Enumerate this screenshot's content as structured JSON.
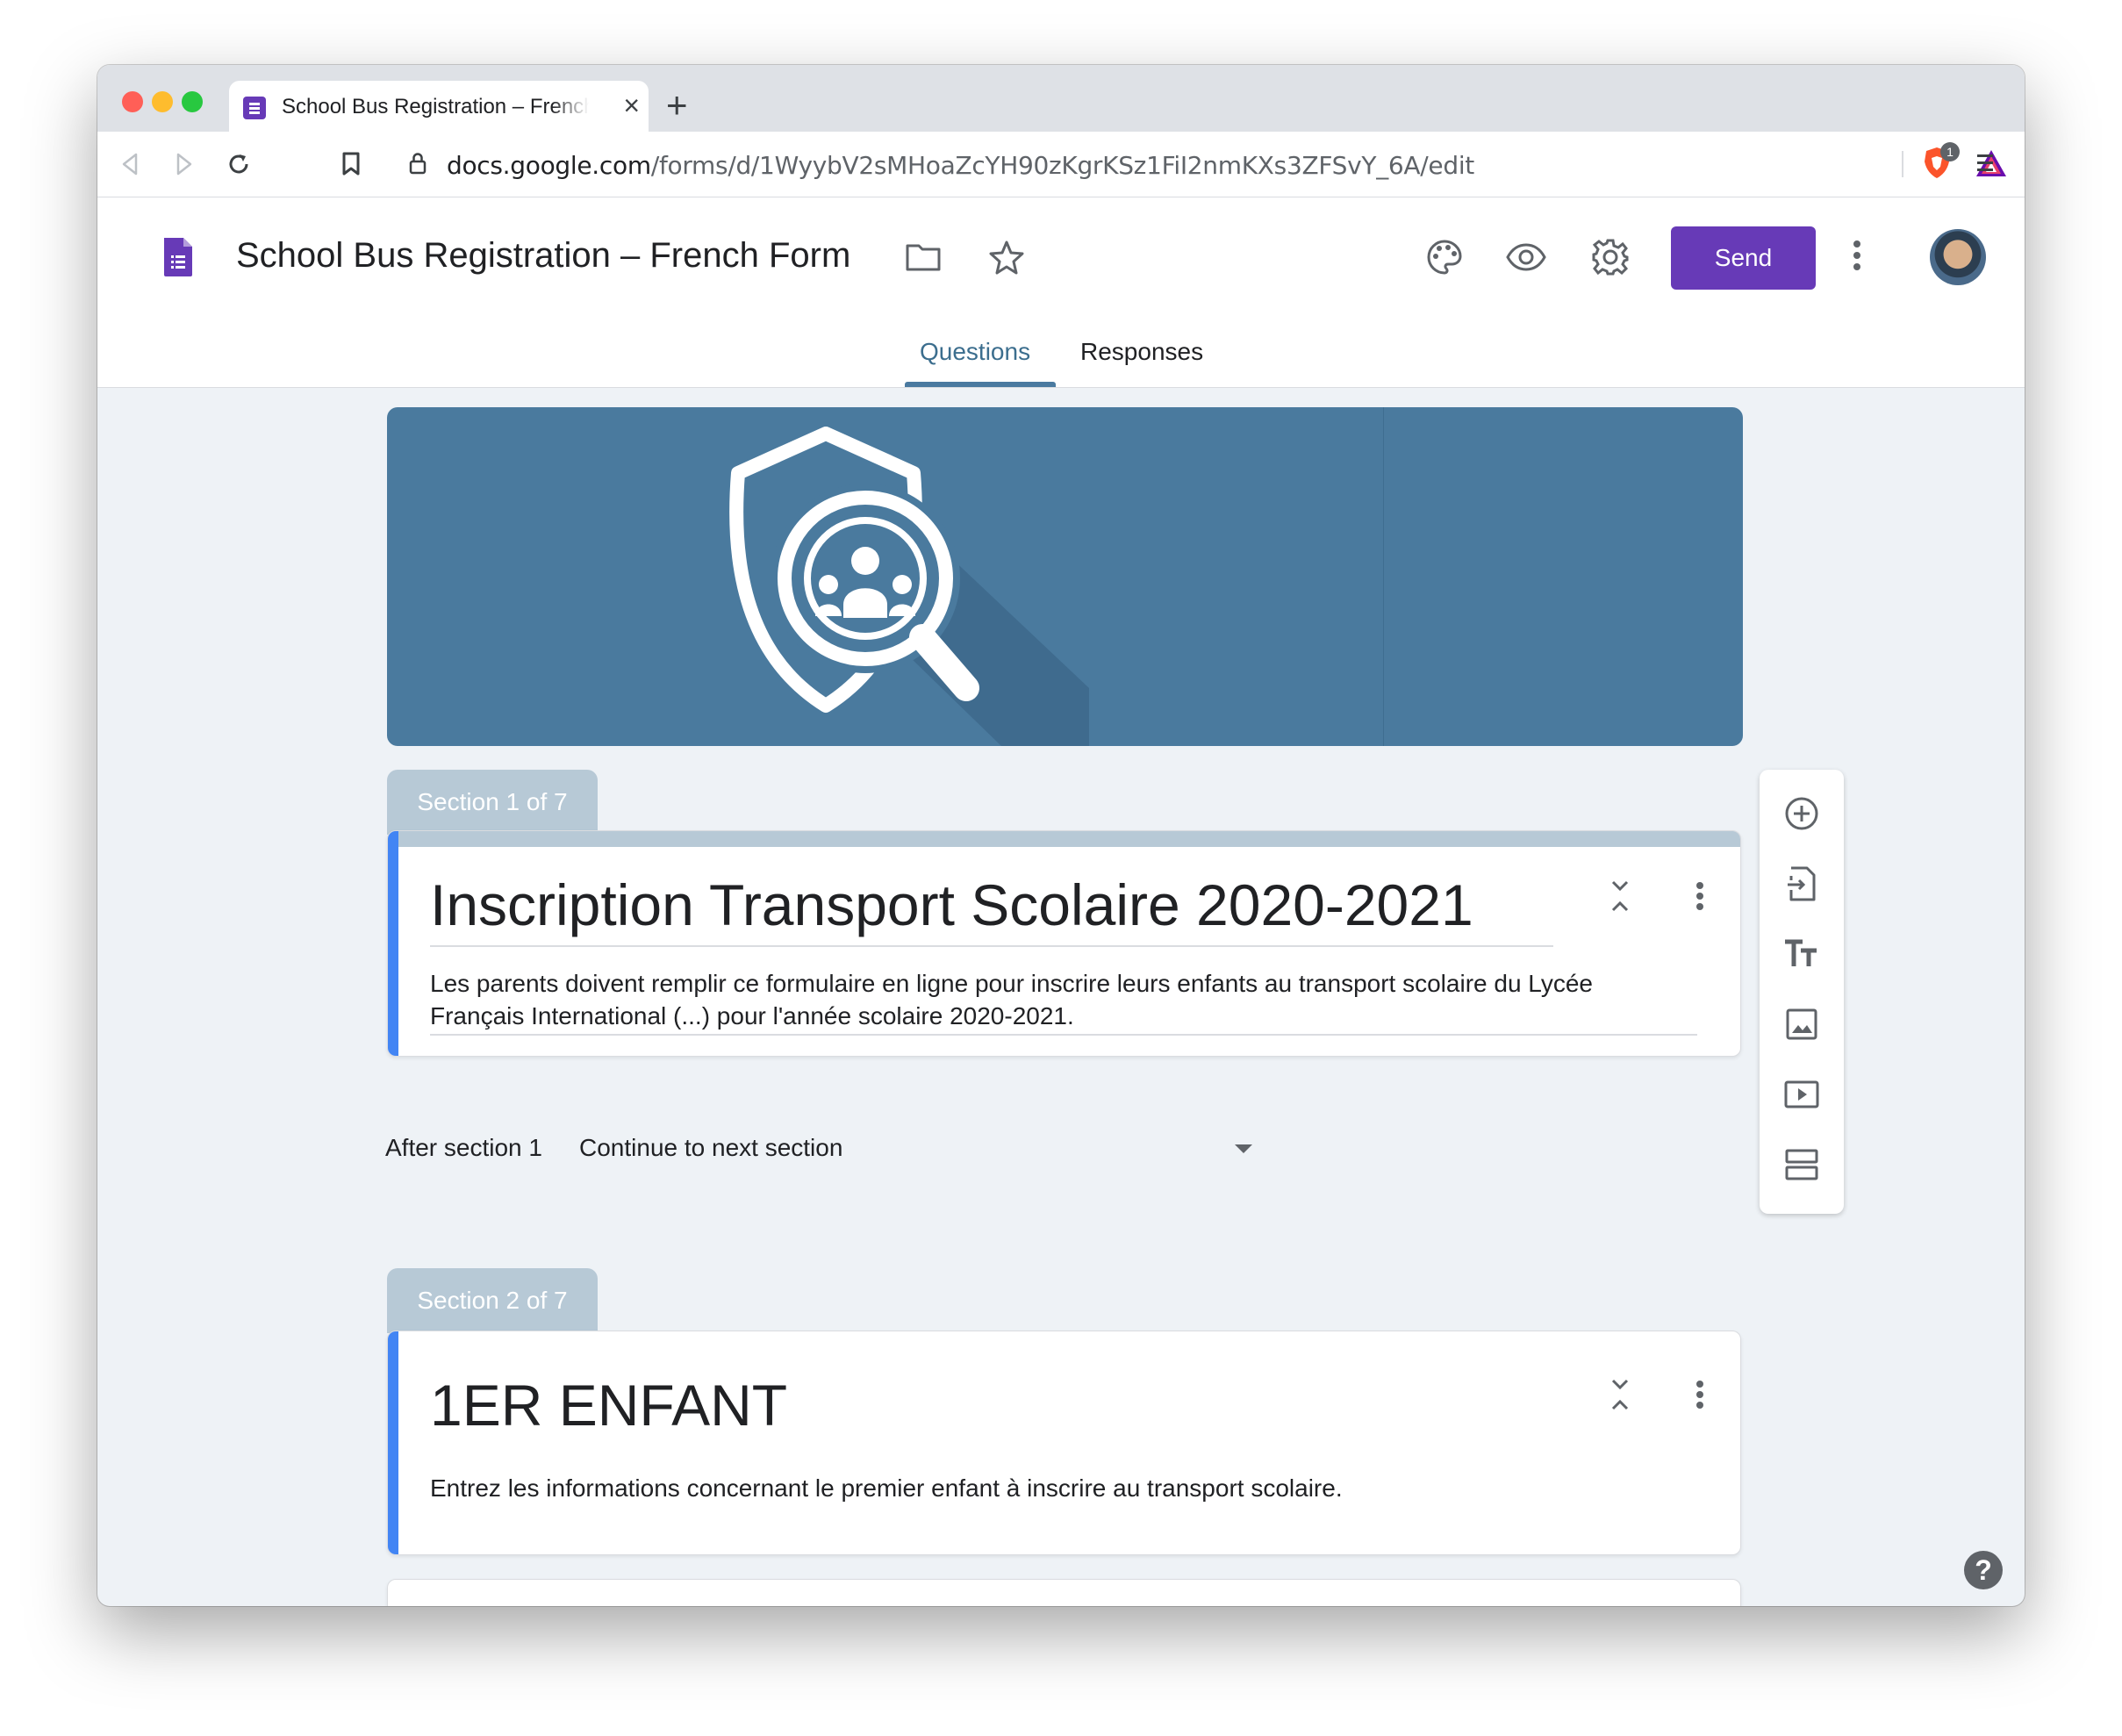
{
  "browser": {
    "tab_title": "School Bus Registration – French Form",
    "new_tab_label": "+",
    "close_label": "×",
    "url_domain": "docs.google.com",
    "url_path": "/forms/d/1WyybV2sMHoaZcYH90zKgrKSz1FiI2nmKXs3ZFSvY_6A/edit",
    "shield_badge": "1",
    "icons": [
      "back-icon",
      "forward-icon",
      "reload-icon",
      "bookmark-icon",
      "lock-icon",
      "brave-shield-icon",
      "brave-rewards-icon",
      "menu-icon"
    ]
  },
  "header": {
    "doc_title": "School Bus Registration – French Form",
    "send_label": "Send",
    "tabs": [
      {
        "label": "Questions",
        "active": true
      },
      {
        "label": "Responses",
        "active": false
      }
    ],
    "accent": "#673ab7"
  },
  "sections": [
    {
      "tab_label": "Section 1 of 7",
      "title": "Inscription Transport Scolaire 2020-2021",
      "description_line1": "Les parents doivent remplir ce formulaire en ligne pour inscrire leurs enfants au transport scolaire du Lycée",
      "description_line2": "Français International (...) pour l'année scolaire 2020-2021.",
      "after_label": "After section 1",
      "after_value": "Continue to next section"
    },
    {
      "tab_label": "Section 2 of 7",
      "title": "1ER ENFANT",
      "description": "Entrez les informations concernant le premier enfant à inscrire au transport scolaire."
    }
  ],
  "side_tools": [
    "add-question-icon",
    "import-questions-icon",
    "add-title-icon",
    "add-image-icon",
    "add-video-icon",
    "add-section-icon"
  ],
  "help_label": "?",
  "colors": {
    "banner": "#4a7a9e",
    "section_tab": "#b7c9d6",
    "left_accent": "#4285f4"
  }
}
